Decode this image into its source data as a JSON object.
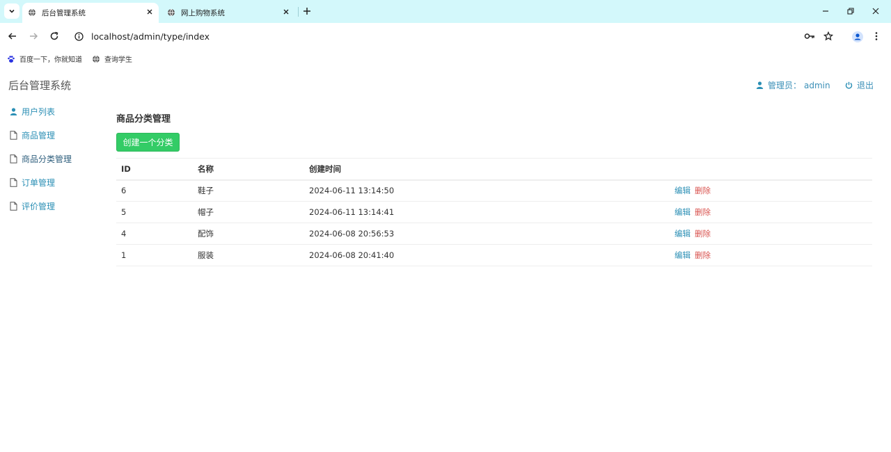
{
  "browser": {
    "tabs": [
      {
        "title": "后台管理系统",
        "active": true
      },
      {
        "title": "网上购物系统",
        "active": false
      }
    ],
    "url": "localhost/admin/type/index",
    "bookmarks": [
      {
        "label": "百度一下，你就知道",
        "icon": "paw-icon"
      },
      {
        "label": "查询学生",
        "icon": "globe-icon"
      }
    ]
  },
  "app": {
    "brand": "后台管理系统",
    "admin_label": "管理员：",
    "admin_name": "admin",
    "logout": "退出"
  },
  "sidebar": {
    "items": [
      {
        "label": "用户列表",
        "icon": "user-icon"
      },
      {
        "label": "商品管理",
        "icon": "file-icon"
      },
      {
        "label": "商品分类管理",
        "icon": "file-icon"
      },
      {
        "label": "订单管理",
        "icon": "file-icon"
      },
      {
        "label": "评价管理",
        "icon": "file-icon"
      }
    ]
  },
  "main": {
    "heading": "商品分类管理",
    "create_button": "创建一个分类",
    "table": {
      "headers": [
        "ID",
        "名称",
        "创建时间",
        ""
      ],
      "rows": [
        {
          "id": "6",
          "name": "鞋子",
          "created": "2024-06-11 13:14:50"
        },
        {
          "id": "5",
          "name": "帽子",
          "created": "2024-06-11 13:14:41"
        },
        {
          "id": "4",
          "name": "配饰",
          "created": "2024-06-08 20:56:53"
        },
        {
          "id": "1",
          "name": "服装",
          "created": "2024-06-08 20:41:40"
        }
      ],
      "edit_label": "编辑",
      "delete_label": "删除"
    }
  },
  "colors": {
    "tabbar_bg": "#d3f8fb",
    "link": "#2b8fb5",
    "danger": "#d9534f",
    "create_button": "#33cc66"
  }
}
